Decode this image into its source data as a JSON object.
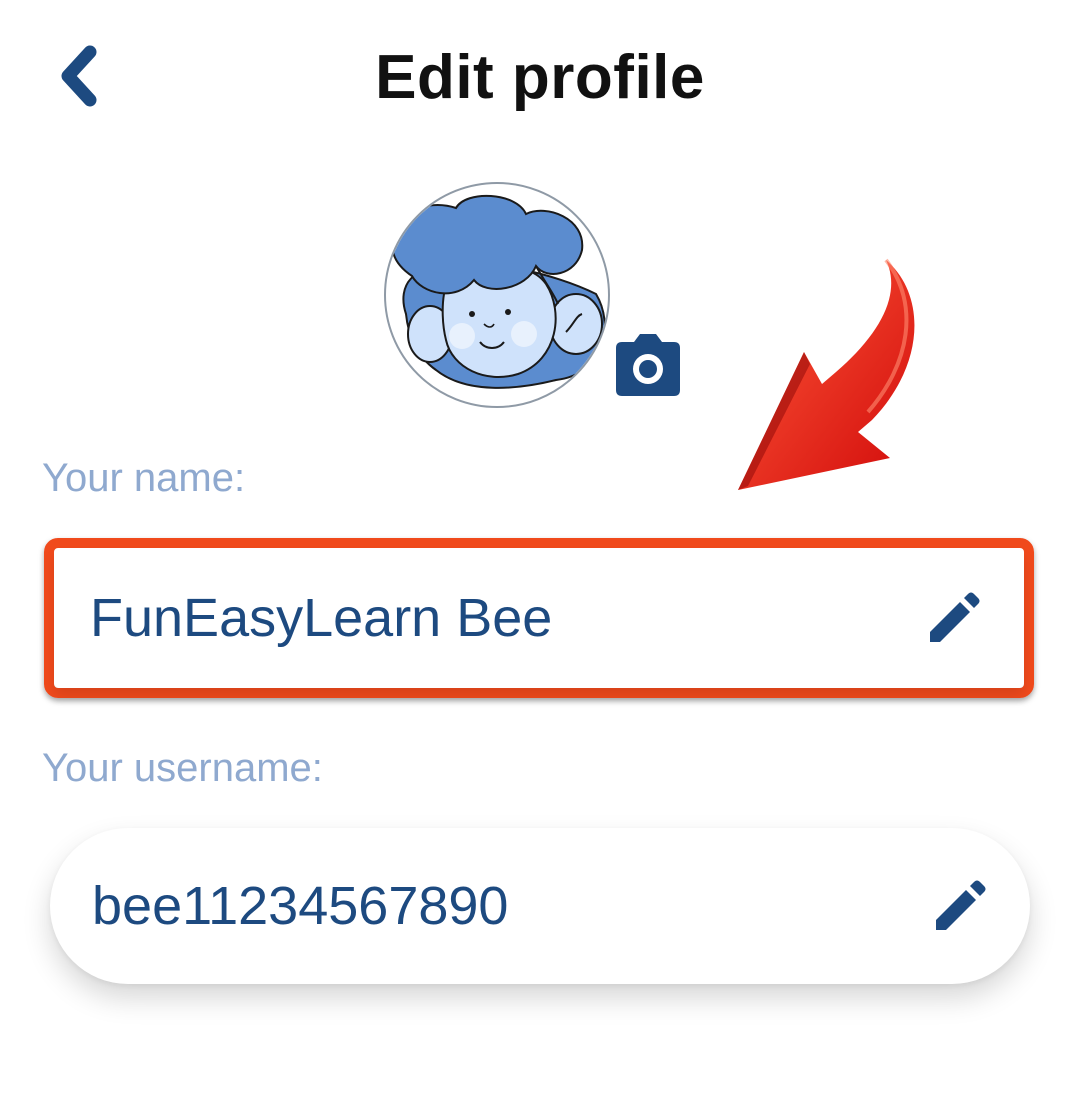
{
  "header": {
    "title": "Edit profile",
    "back_icon": "chevron-left-icon"
  },
  "avatar": {
    "image": "cartoon-avatar",
    "camera_icon": "camera-icon"
  },
  "form": {
    "name": {
      "label": "Your name:",
      "value": "FunEasyLearn Bee",
      "edit_icon": "pencil-icon"
    },
    "username": {
      "label": "Your username:",
      "value": "bee11234567890",
      "edit_icon": "pencil-icon"
    }
  },
  "colors": {
    "accent": "#1d4a80",
    "label": "#8fa9cf",
    "highlight": "#f04a1c",
    "arrow": "#e01e10"
  }
}
